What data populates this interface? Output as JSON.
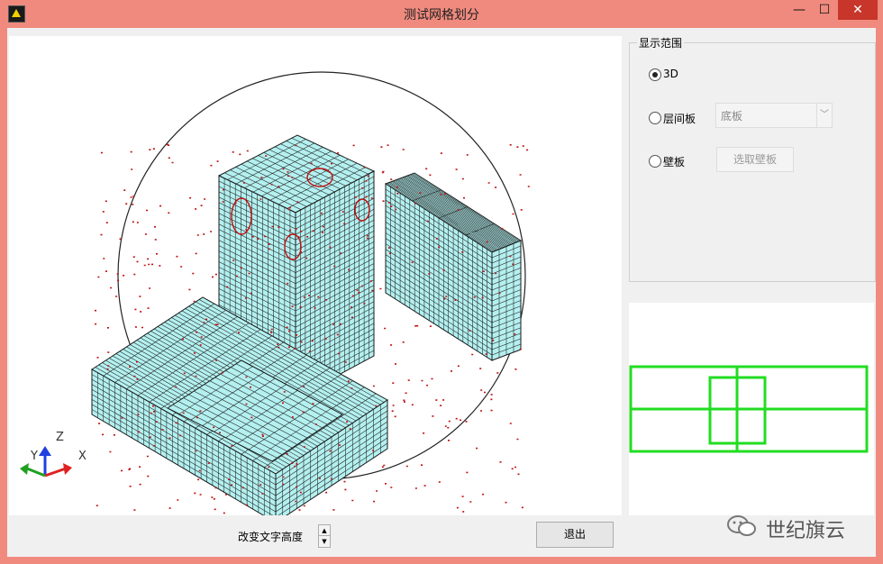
{
  "window": {
    "title": "测试网格划分"
  },
  "titlebar": {
    "min_glyph": "—",
    "max_glyph": "☐",
    "close_glyph": "✕"
  },
  "display_range": {
    "title": "显示范围",
    "options": [
      {
        "label": "3D",
        "selected": true
      },
      {
        "label": "层间板",
        "selected": false
      },
      {
        "label": "壁板",
        "selected": false
      }
    ],
    "floor_select": {
      "value": "底板",
      "enabled": false
    },
    "pick_wall_button": {
      "label": "选取壁板",
      "enabled": false
    }
  },
  "axes": {
    "x": "X",
    "y": "Y",
    "z": "Z"
  },
  "axis_colors": {
    "x": "#e02020",
    "y": "#20a020",
    "z": "#1f3fe0"
  },
  "mesh_colors": {
    "fill": "#b4f0f0",
    "line": "#1a1a1a",
    "node": "#c01010"
  },
  "preview_color": "#22dd22",
  "bottom": {
    "text_height_label": "改变文字高度",
    "exit_label": "退出",
    "spin_up": "▲",
    "spin_down": "▼"
  },
  "watermark": {
    "text": "世纪旗云",
    "icon": "wechat-icon"
  }
}
